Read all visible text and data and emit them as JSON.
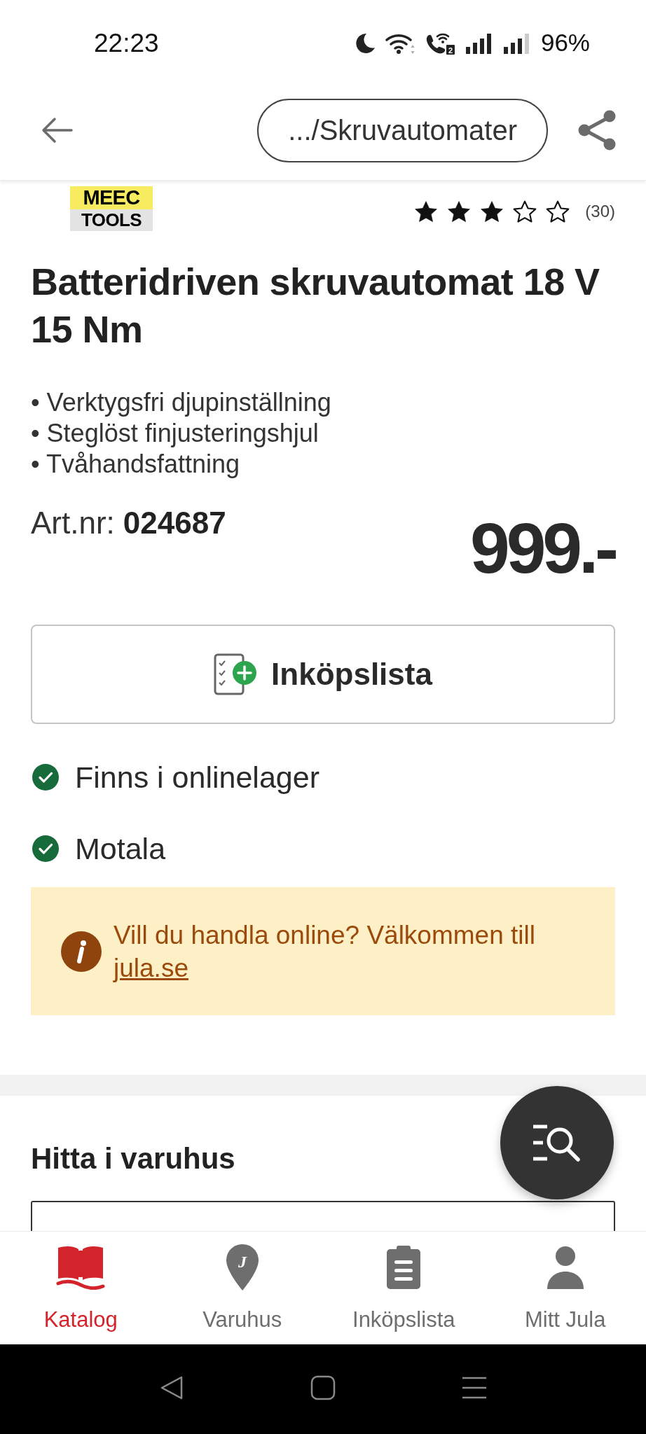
{
  "status_bar": {
    "time": "22:23",
    "sim_label": "2",
    "battery": "96%"
  },
  "header": {
    "breadcrumb": ".../Skruvautomater"
  },
  "product": {
    "brand_logo": [
      "MEEC",
      "TOOLS"
    ],
    "stars": 3,
    "review_count": "(30)",
    "title": "Batteridriven skruvautomat 18 V 15 Nm",
    "features": [
      "• Verktygsfri djupinställning",
      "• Steglöst finjusteringshjul",
      "• Tvåhandsfattning"
    ],
    "article_label": "Art.nr:",
    "article_number": "024687",
    "price": "999.-"
  },
  "shopping_list_button": {
    "label": "Inköpslista"
  },
  "stock": [
    {
      "label": "Finns i onlinelager",
      "available": true
    },
    {
      "label": "Motala",
      "available": true
    }
  ],
  "info_notice": {
    "text": "Vill du handla online? Välkommen till",
    "link": "jula.se"
  },
  "store_section": {
    "title": "Hitta i varuhus"
  },
  "bottom_nav": [
    {
      "kind": "catalog",
      "label": "Katalog",
      "selected": true
    },
    {
      "kind": "store",
      "label": "Varuhus",
      "badge": "J",
      "selected": false
    },
    {
      "kind": "list",
      "label": "Inköpslista",
      "selected": false
    },
    {
      "kind": "account",
      "label": "Mitt Jula",
      "selected": false
    }
  ]
}
